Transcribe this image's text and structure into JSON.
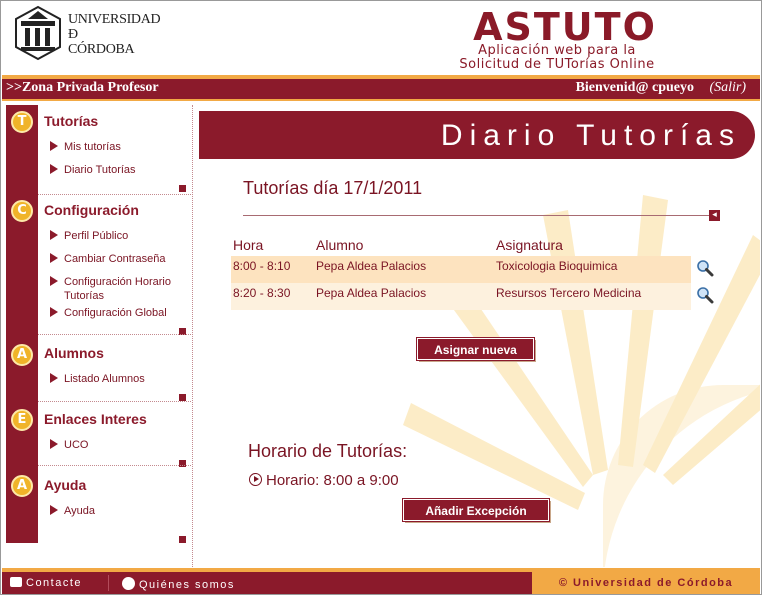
{
  "header": {
    "university_lines": [
      "UNIVERSIDAD",
      "Ð",
      "CÓRDOBA"
    ],
    "app_title": "ASTUTO",
    "app_subtitle_lines": [
      "Aplicación web para la",
      "Solicitud de TUTorías Online"
    ]
  },
  "topbar": {
    "zone": ">>Zona Privada Profesor",
    "welcome": "Bienvenid@ cpueyo",
    "logout": "(Salir)"
  },
  "sidebar": {
    "sections": [
      {
        "badge": "T",
        "title": "Tutorías",
        "items": [
          "Mis tutorías",
          "Diario Tutorías"
        ]
      },
      {
        "badge": "C",
        "title": "Configuración",
        "items": [
          "Perfil Público",
          "Cambiar Contraseña",
          "Configuración Horario Tutorías",
          "Configuración Global"
        ]
      },
      {
        "badge": "A",
        "title": "Alumnos",
        "items": [
          "Listado Alumnos"
        ]
      },
      {
        "badge": "E",
        "title": "Enlaces Interes",
        "items": [
          "UCO"
        ]
      },
      {
        "badge": "A",
        "title": "Ayuda",
        "items": [
          "Ayuda"
        ]
      }
    ]
  },
  "main": {
    "banner": "Diario Tutorías",
    "day_title": "Tutorías día 17/1/2011",
    "table": {
      "headers": [
        "Hora",
        "Alumno",
        "Asignatura"
      ],
      "rows": [
        [
          "8:00 - 8:10",
          "Pepa Aldea Palacios",
          "Toxicologia Bioquimica"
        ],
        [
          "8:20 - 8:30",
          "Pepa Aldea Palacios",
          "Resursos Tercero Medicina"
        ]
      ]
    },
    "assign_button": "Asignar nueva",
    "schedule_title": "Horario de Tutorías:",
    "schedule_line": "Horario: 8:00 a 9:00",
    "exception_button": "Añadir Excepción"
  },
  "footer": {
    "contact": "Contacte",
    "about": "Quiénes somos",
    "copyright": "© Universidad de Córdoba"
  },
  "colors": {
    "primary": "#8b1a2b",
    "accent": "#f2a945",
    "row_a": "#fde3bf",
    "row_b": "#fdf1de"
  },
  "icons": [
    "university-crest-icon",
    "magnifier-icon",
    "play-circle-icon",
    "mail-icon",
    "user-icon",
    "back-arrow-icon"
  ]
}
